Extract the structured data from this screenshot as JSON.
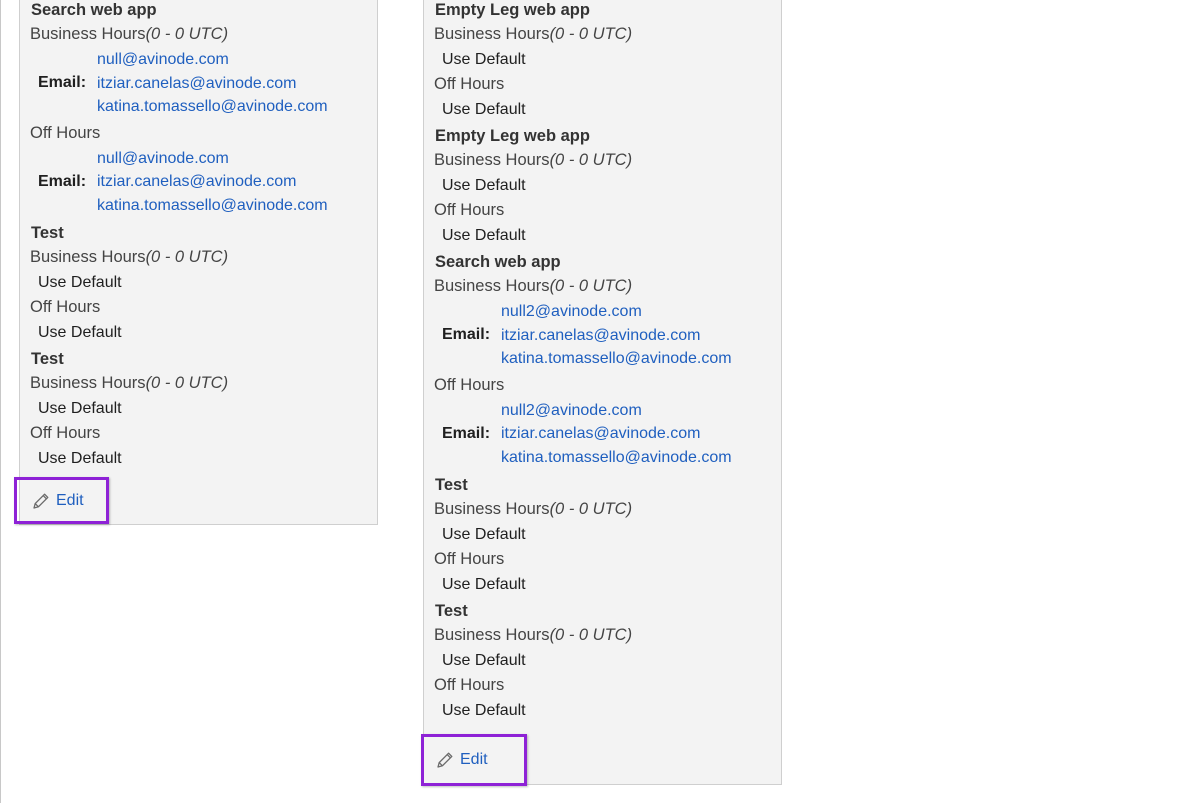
{
  "left_panel": {
    "sections": [
      {
        "title": "Search web app",
        "business_label": "Business Hours",
        "business_tz": "(0 - 0 UTC)",
        "business_email_label": "Email:",
        "business_emails": [
          "null@avinode.com",
          "itziar.canelas@avinode.com",
          "katina.tomassello@avinode.com"
        ],
        "off_label": "Off Hours",
        "off_email_label": "Email:",
        "off_emails": [
          "null@avinode.com",
          "itziar.canelas@avinode.com",
          "katina.tomassello@avinode.com"
        ]
      },
      {
        "title": "Test",
        "business_label": "Business Hours",
        "business_tz": "(0 - 0 UTC)",
        "business_default": "Use Default",
        "off_label": "Off Hours",
        "off_default": "Use Default"
      },
      {
        "title": "Test",
        "business_label": "Business Hours",
        "business_tz": "(0 - 0 UTC)",
        "business_default": "Use Default",
        "off_label": "Off Hours",
        "off_default": "Use Default"
      }
    ],
    "edit_label": "Edit"
  },
  "right_panel": {
    "sections": [
      {
        "title": "Empty Leg web app",
        "business_label": "Business Hours",
        "business_tz": "(0 - 0 UTC)",
        "business_default": "Use Default",
        "off_label": "Off Hours",
        "off_default": "Use Default"
      },
      {
        "title": "Empty Leg web app",
        "business_label": "Business Hours",
        "business_tz": "(0 - 0 UTC)",
        "business_default": "Use Default",
        "off_label": "Off Hours",
        "off_default": "Use Default"
      },
      {
        "title": "Search web app",
        "business_label": "Business Hours",
        "business_tz": "(0 - 0 UTC)",
        "business_email_label": "Email:",
        "business_emails": [
          "null2@avinode.com",
          "itziar.canelas@avinode.com",
          "katina.tomassello@avinode.com"
        ],
        "off_label": "Off Hours",
        "off_email_label": "Email:",
        "off_emails": [
          "null2@avinode.com",
          "itziar.canelas@avinode.com",
          "katina.tomassello@avinode.com"
        ]
      },
      {
        "title": "Test",
        "business_label": "Business Hours",
        "business_tz": "(0 - 0 UTC)",
        "business_default": "Use Default",
        "off_label": "Off Hours",
        "off_default": "Use Default"
      },
      {
        "title": "Test",
        "business_label": "Business Hours",
        "business_tz": "(0 - 0 UTC)",
        "business_default": "Use Default",
        "off_label": "Off Hours",
        "off_default": "Use Default"
      }
    ],
    "edit_label": "Edit"
  },
  "colors": {
    "highlight": "#8e22d6",
    "link": "#1f5fbf",
    "panel_bg": "#f3f3f3"
  },
  "icons": {
    "edit": "pencil-icon"
  }
}
